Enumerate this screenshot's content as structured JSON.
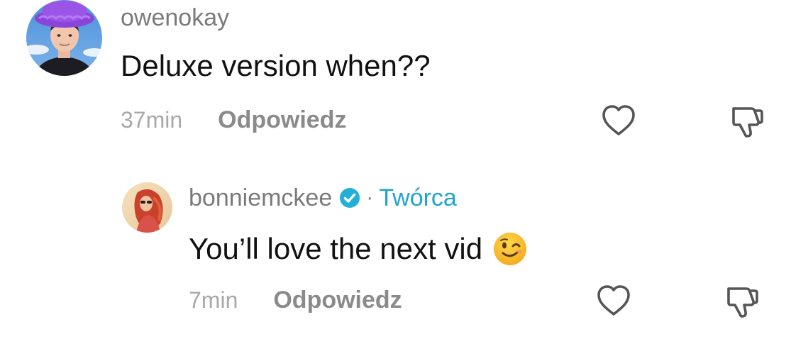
{
  "comments": [
    {
      "username": "owenokay",
      "text": "Deluxe version when??",
      "time": "37min",
      "reply_label": "Odpowiedz",
      "avatar_icon": "avatar-purple-hat"
    }
  ],
  "replies": [
    {
      "username": "bonniemckee",
      "verified": true,
      "verified_color": "#20B0D8",
      "separator": "·",
      "role_label": "Twórca",
      "role_color": "#1FA5CC",
      "text": "You’ll love the next vid",
      "emoji": "winking-face",
      "time": "7min",
      "reply_label": "Odpowiedz",
      "avatar_icon": "avatar-red-hair"
    }
  ],
  "icons": {
    "like": "heart-outline-icon",
    "dislike": "thumbs-down-outline-icon"
  }
}
